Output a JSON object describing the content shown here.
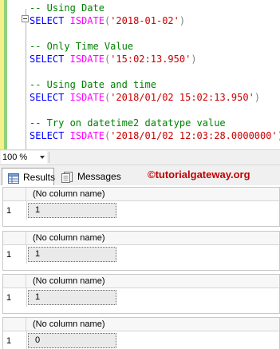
{
  "editor": {
    "lines": [
      {
        "comment": "-- Using Date"
      },
      {
        "keyword": "SELECT",
        "function": "ISDATE",
        "open": "(",
        "string": "'2018-01-02'",
        "close": ")"
      },
      {
        "comment": "-- Only Time Value"
      },
      {
        "keyword": "SELECT",
        "function": "ISDATE",
        "open": "(",
        "string": "'15:02:13.950'",
        "close": ")"
      },
      {
        "comment": "-- Using Date and time"
      },
      {
        "keyword": "SELECT",
        "function": "ISDATE",
        "open": "(",
        "string": "'2018/01/02 15:02:13.950'",
        "close": ")"
      },
      {
        "comment": "-- Try on datetime2 datatype value"
      },
      {
        "keyword": "SELECT",
        "function": "ISDATE",
        "open": "(",
        "string": "'2018/01/02 12:03:28.0000000'",
        "close": ")"
      }
    ]
  },
  "zoom": {
    "value": "100 %"
  },
  "tabs": {
    "results_label": "Results",
    "messages_label": "Messages"
  },
  "watermark": "©tutorialgateway.org",
  "results": [
    {
      "column": "(No column name)",
      "row": "1",
      "value": "1"
    },
    {
      "column": "(No column name)",
      "row": "1",
      "value": "1"
    },
    {
      "column": "(No column name)",
      "row": "1",
      "value": "1"
    },
    {
      "column": "(No column name)",
      "row": "1",
      "value": "0"
    }
  ],
  "colors": {
    "keyword": "#0000ff",
    "function": "#ff00ff",
    "string": "#cc0000",
    "comment": "#008000",
    "watermark": "#c00000"
  }
}
